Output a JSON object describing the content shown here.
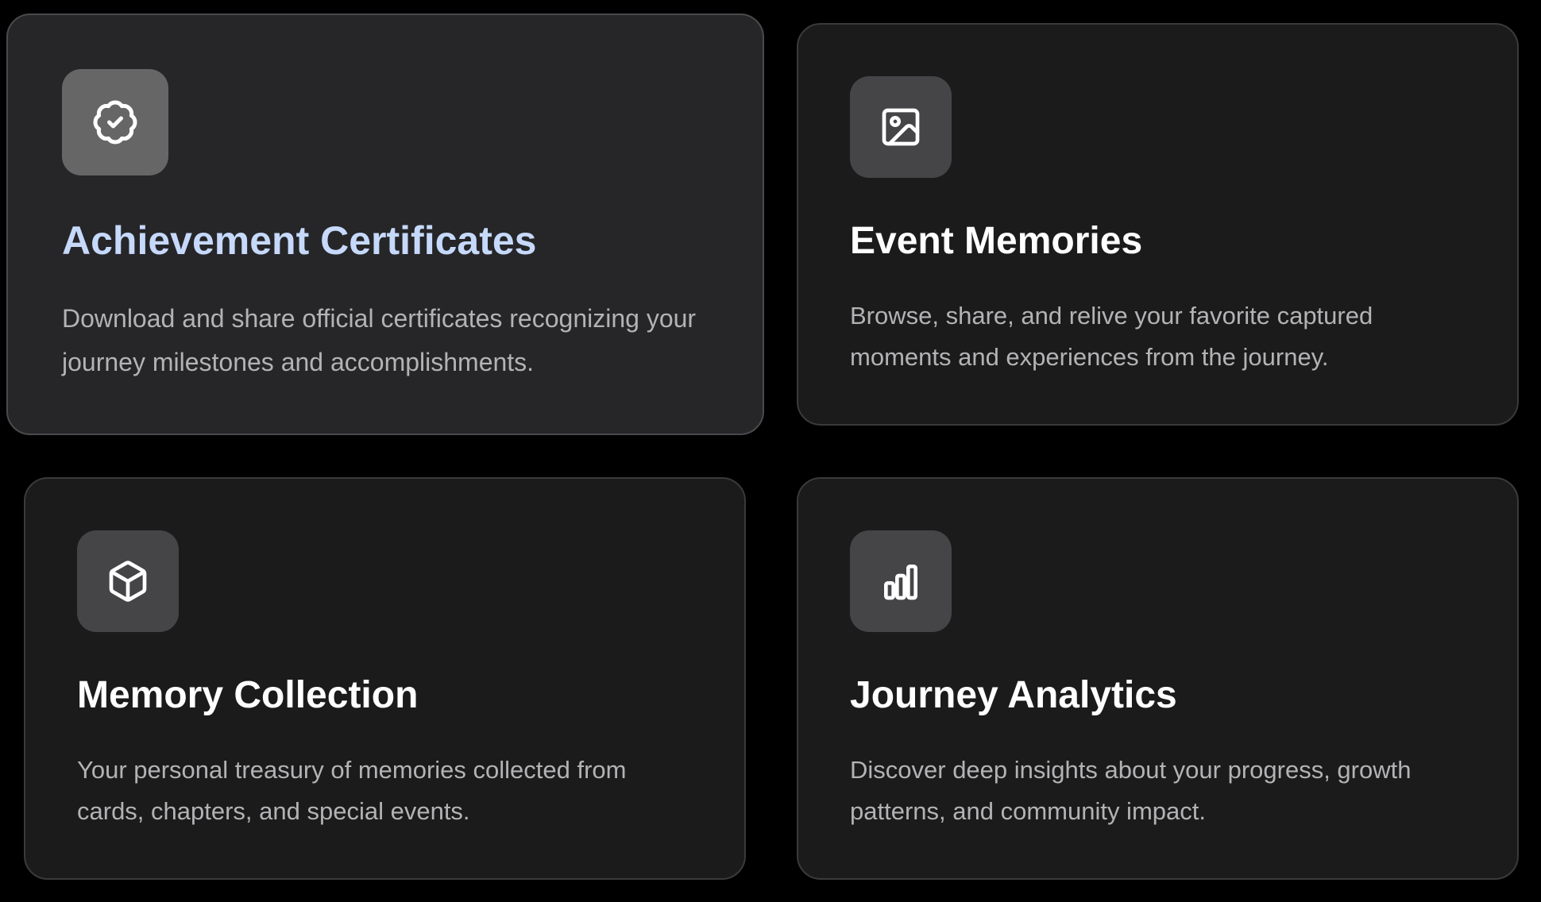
{
  "cards": [
    {
      "icon": "badge-check-icon",
      "title": "Achievement Certificates",
      "description": "Download and share official certificates recognizing your journey milestones and accomplishments.",
      "state": "hovered",
      "title_color": "#c6d9fb"
    },
    {
      "icon": "image-icon",
      "title": "Event Memories",
      "description": "Browse, share, and relive your favorite captured moments and experiences from the journey."
    },
    {
      "icon": "box-icon",
      "title": "Memory Collection",
      "description": "Your personal treasury of memories collected from cards, chapters, and special events."
    },
    {
      "icon": "bar-chart-icon",
      "title": "Journey Analytics",
      "description": "Discover deep insights about your progress, growth patterns, and community impact."
    }
  ],
  "colors": {
    "page_background": "#000000",
    "card_background": "#1b1b1c",
    "card_background_hovered": "#262628",
    "card_border": "#3a3a3c",
    "icon_tile": "#454547",
    "icon_tile_hovered": "#666667",
    "title": "#ffffff",
    "description": "#b3b3b5"
  }
}
